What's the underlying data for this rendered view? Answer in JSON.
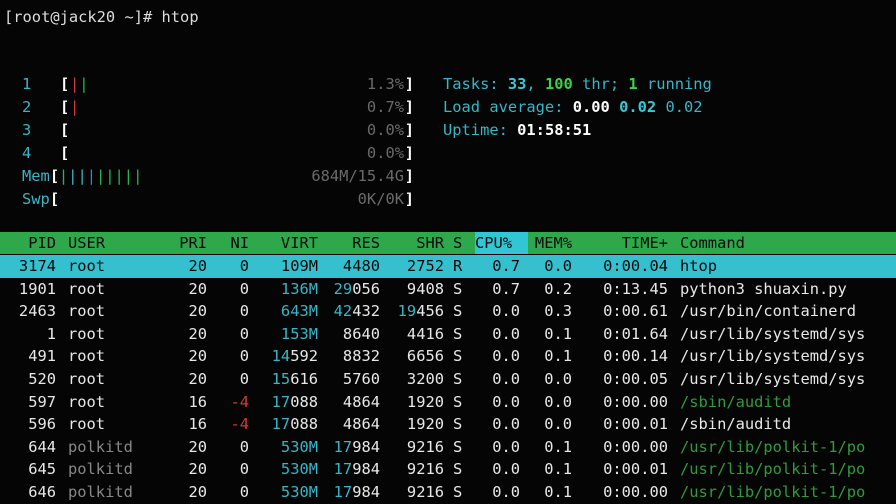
{
  "prompt": "[root@jack20 ~]# htop",
  "meters": [
    {
      "label": "1",
      "value": "1.3%",
      "bars": [
        {
          "c": "c-red",
          "t": "|"
        },
        {
          "c": "c-grn",
          "t": "|"
        }
      ]
    },
    {
      "label": "2",
      "value": "0.7%",
      "bars": [
        {
          "c": "c-red",
          "t": "|"
        }
      ]
    },
    {
      "label": "3",
      "value": "0.0%",
      "bars": []
    },
    {
      "label": "4",
      "value": "0.0%",
      "bars": []
    },
    {
      "label": "Mem",
      "value": "684M/15.4G",
      "bars": [
        {
          "c": "c-grn",
          "t": "|"
        },
        {
          "c": "c-cyan",
          "t": "||"
        },
        {
          "c": "c-blue",
          "t": "|"
        },
        {
          "c": "c-grn",
          "t": "|||||"
        }
      ]
    },
    {
      "label": "Swp",
      "value": "0K/0K",
      "bars": []
    }
  ],
  "system": {
    "tasks_label": "Tasks: ",
    "tasks": "33",
    "sep1": ", ",
    "threads": "100",
    "thr_label": " thr; ",
    "running": "1",
    "running_label": " running",
    "load_label": "Load average: ",
    "load1": "0.00",
    "load5": "0.02",
    "load15": "0.02",
    "uptime_label": "Uptime: ",
    "uptime": "01:58:51"
  },
  "columns": [
    "PID",
    "USER",
    "PRI",
    "NI",
    "VIRT",
    "RES",
    "SHR",
    "S",
    "CPU%",
    "MEM%",
    "TIME+",
    "Command"
  ],
  "rows": [
    {
      "pid": "3174",
      "user": "root",
      "pri": "20",
      "ni": "0",
      "virt": "109M",
      "res": "4480",
      "shr": "2752",
      "s": "R",
      "cpu": "0.7",
      "mem": "0.0",
      "time": "0:00.04",
      "cmd": "htop",
      "sel": true
    },
    {
      "pid": "1901",
      "user": "root",
      "pri": "20",
      "ni": "0",
      "virt": "136M",
      "res": "29056",
      "shr": "9408",
      "s": "S",
      "cpu": "0.7",
      "mem": "0.2",
      "time": "0:13.45",
      "cmd": "python3 shuaxin.py"
    },
    {
      "pid": "2463",
      "user": "root",
      "pri": "20",
      "ni": "0",
      "virt": "643M",
      "res": "42432",
      "shr": "19456",
      "s": "S",
      "cpu": "0.0",
      "mem": "0.3",
      "time": "0:00.61",
      "cmd": "/usr/bin/containerd"
    },
    {
      "pid": "1",
      "user": "root",
      "pri": "20",
      "ni": "0",
      "virt": "153M",
      "res": "8640",
      "shr": "4416",
      "s": "S",
      "cpu": "0.0",
      "mem": "0.1",
      "time": "0:01.64",
      "cmd": "/usr/lib/systemd/sys"
    },
    {
      "pid": "491",
      "user": "root",
      "pri": "20",
      "ni": "0",
      "virt": "14592",
      "res": "8832",
      "shr": "6656",
      "s": "S",
      "cpu": "0.0",
      "mem": "0.1",
      "time": "0:00.14",
      "cmd": "/usr/lib/systemd/sys"
    },
    {
      "pid": "520",
      "user": "root",
      "pri": "20",
      "ni": "0",
      "virt": "15616",
      "res": "5760",
      "shr": "3200",
      "s": "S",
      "cpu": "0.0",
      "mem": "0.0",
      "time": "0:00.05",
      "cmd": "/usr/lib/systemd/sys"
    },
    {
      "pid": "597",
      "user": "root",
      "pri": "16",
      "ni": "-4",
      "virt": "17088",
      "res": "4864",
      "shr": "1920",
      "s": "S",
      "cpu": "0.0",
      "mem": "0.0",
      "time": "0:00.00",
      "cmd": "/sbin/auditd",
      "thread": true
    },
    {
      "pid": "596",
      "user": "root",
      "pri": "16",
      "ni": "-4",
      "virt": "17088",
      "res": "4864",
      "shr": "1920",
      "s": "S",
      "cpu": "0.0",
      "mem": "0.0",
      "time": "0:00.01",
      "cmd": "/sbin/auditd"
    },
    {
      "pid": "644",
      "user": "polkitd",
      "pri": "20",
      "ni": "0",
      "virt": "530M",
      "res": "17984",
      "shr": "9216",
      "s": "S",
      "cpu": "0.0",
      "mem": "0.1",
      "time": "0:00.00",
      "cmd": "/usr/lib/polkit-1/po",
      "thread": true,
      "dimuser": true
    },
    {
      "pid": "645",
      "user": "polkitd",
      "pri": "20",
      "ni": "0",
      "virt": "530M",
      "res": "17984",
      "shr": "9216",
      "s": "S",
      "cpu": "0.0",
      "mem": "0.1",
      "time": "0:00.01",
      "cmd": "/usr/lib/polkit-1/po",
      "thread": true,
      "dimuser": true
    },
    {
      "pid": "646",
      "user": "polkitd",
      "pri": "20",
      "ni": "0",
      "virt": "530M",
      "res": "17984",
      "shr": "9216",
      "s": "S",
      "cpu": "0.0",
      "mem": "0.1",
      "time": "0:00.00",
      "cmd": "/usr/lib/polkit-1/po",
      "thread": true,
      "dimuser": true
    }
  ]
}
